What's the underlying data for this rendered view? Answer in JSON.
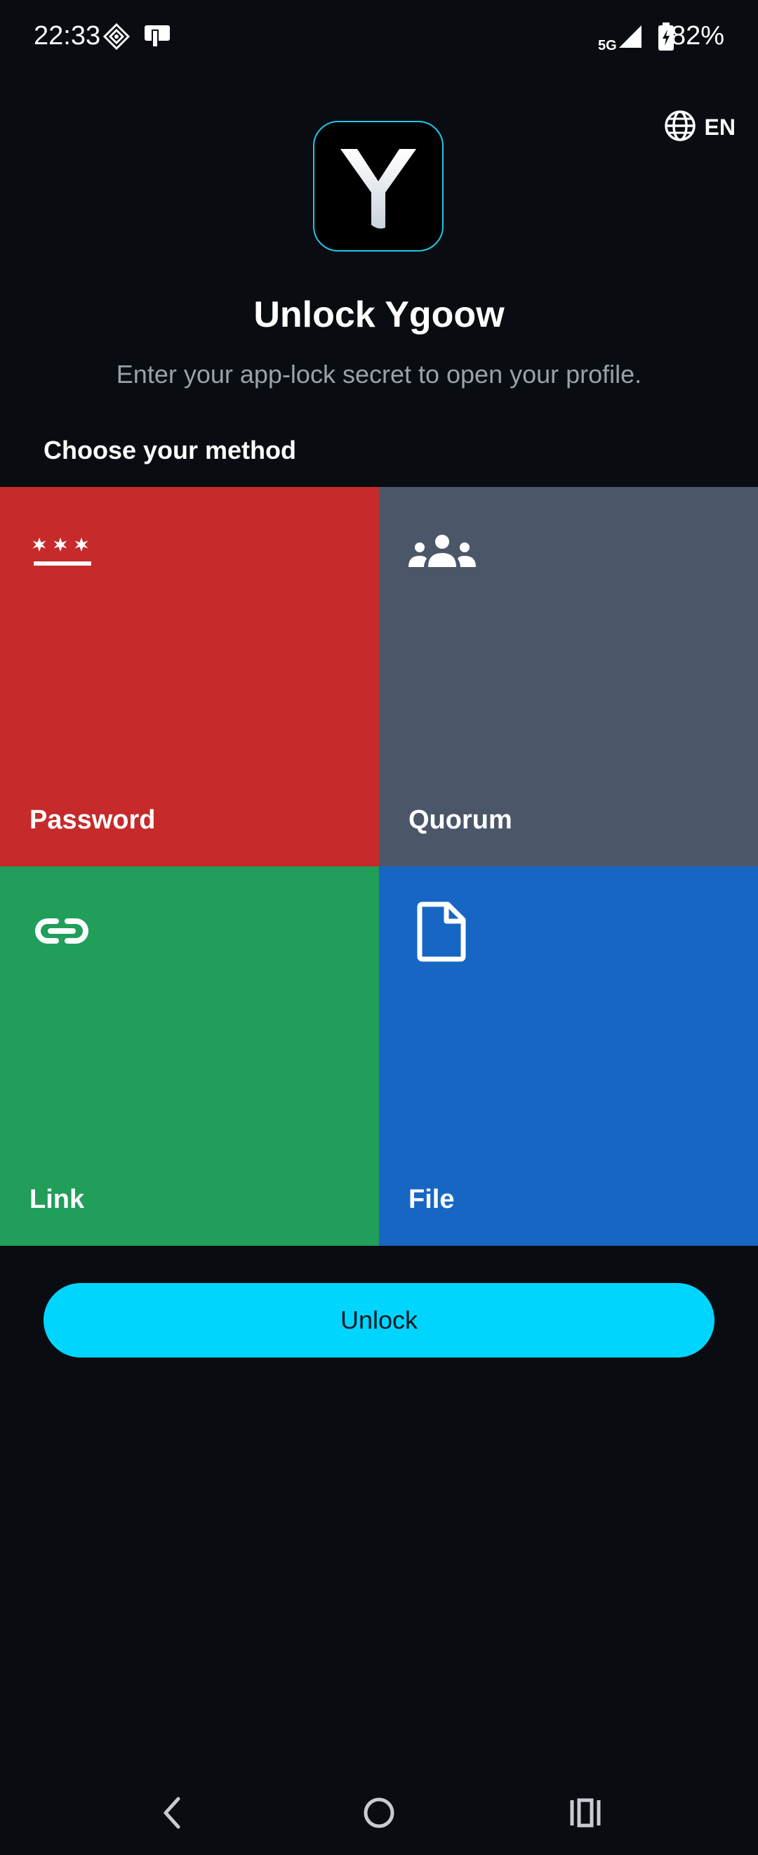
{
  "status_bar": {
    "time": "22:33",
    "network": "5G",
    "battery": "82%"
  },
  "language": {
    "label": "EN",
    "icon": "globe-icon"
  },
  "logo": {
    "letter": "Y",
    "accent_color": "#1fc8e8"
  },
  "header": {
    "title": "Unlock Ygoow",
    "subtitle": "Enter your app-lock secret to open your profile."
  },
  "methods": {
    "section_label": "Choose your method",
    "items": [
      {
        "label": "Password",
        "icon": "password-icon",
        "color": "#c62a2a"
      },
      {
        "label": "Quorum",
        "icon": "group-icon",
        "color": "#4b5669"
      },
      {
        "label": "Link",
        "icon": "link-icon",
        "color": "#209e5a"
      },
      {
        "label": "File",
        "icon": "file-icon",
        "color": "#1766c4"
      }
    ]
  },
  "actions": {
    "unlock_label": "Unlock",
    "unlock_color": "#00d5ff"
  },
  "nav": {
    "back_icon": "back-icon",
    "home_icon": "home-icon",
    "recents_icon": "recents-icon"
  }
}
